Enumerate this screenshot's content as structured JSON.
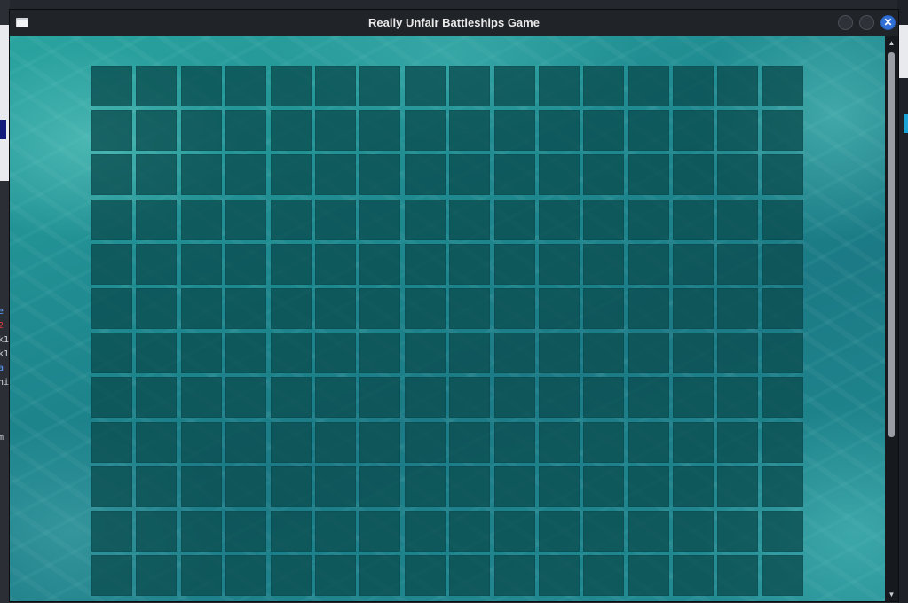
{
  "window": {
    "title": "Really Unfair Battleships Game",
    "icon": "app-window-icon",
    "buttons": [
      {
        "name": "minimize",
        "icon": "minimize-icon"
      },
      {
        "name": "maximize",
        "icon": "maximize-icon"
      },
      {
        "name": "close",
        "icon": "close-icon",
        "glyph": "✕"
      }
    ]
  },
  "board": {
    "columns": 16,
    "visible_rows": 12,
    "cell_color": "#0a4b4e",
    "background": "ocean-water-texture"
  },
  "scrollbar": {
    "up_glyph": "▲",
    "down_glyph": "▼"
  },
  "desktop": {
    "left_glyphs": [
      "e",
      "2",
      "k1",
      "k1",
      "a",
      "ni",
      "m"
    ]
  },
  "colors": {
    "titlebar": "#202328",
    "close_button": "#2f6fd6",
    "water": "#1f8a90"
  }
}
